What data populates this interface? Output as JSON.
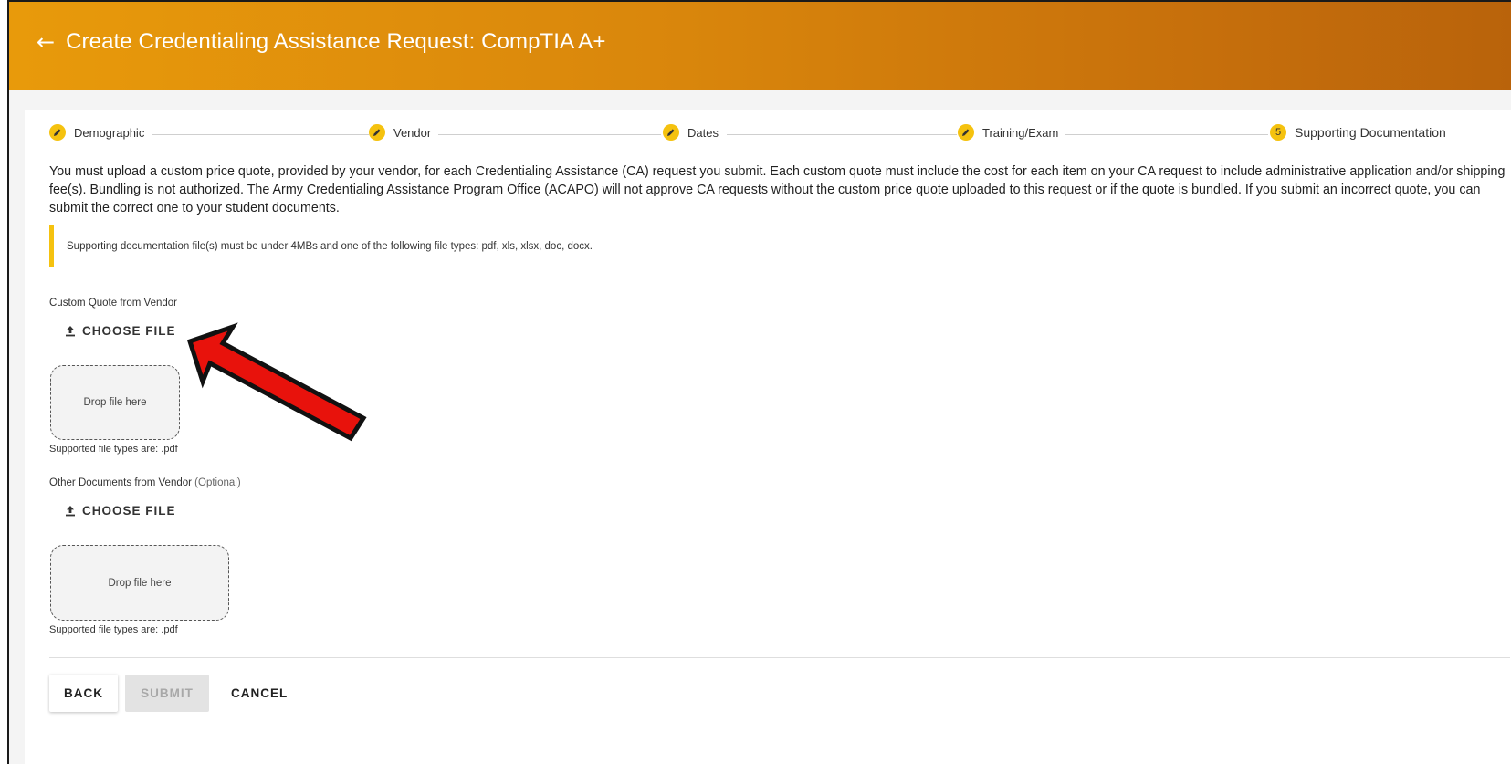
{
  "header": {
    "back_icon": "arrow-left-icon",
    "title": "Create Credentialing Assistance Request: CompTIA A+"
  },
  "stepper": {
    "steps": [
      {
        "label": "Demographic",
        "status": "complete",
        "icon": "pencil-icon"
      },
      {
        "label": "Vendor",
        "status": "complete",
        "icon": "pencil-icon"
      },
      {
        "label": "Dates",
        "status": "complete",
        "icon": "pencil-icon"
      },
      {
        "label": "Training/Exam",
        "status": "complete",
        "icon": "pencil-icon"
      },
      {
        "label": "Supporting Documentation",
        "status": "active",
        "number": "5"
      }
    ]
  },
  "intro_text": "You must upload a custom price quote, provided by your vendor, for each Credentialing Assistance (CA) request you submit. Each custom quote must include the cost for each item on your CA request to include administrative application and/or shipping fee(s). Bundling is not authorized. The Army Credentialing Assistance Program Office (ACAPO) will not approve CA requests without the custom price quote uploaded to this request or if the quote is bundled. If you submit an incorrect quote, you can submit the correct one to your student documents.",
  "note": "Supporting documentation file(s) must be under 4MBs and one of the following file types: pdf, xls, xlsx, doc, docx.",
  "custom_quote": {
    "label": "Custom Quote from Vendor",
    "choose_label": "CHOOSE FILE",
    "drop_text": "Drop file here",
    "supported": "Supported file types are: .pdf"
  },
  "other_docs": {
    "label": "Other Documents from Vendor",
    "optional": "(Optional)",
    "choose_label": "CHOOSE FILE",
    "drop_text": "Drop file here",
    "supported": "Supported file types are: .pdf"
  },
  "actions": {
    "back": "BACK",
    "submit": "SUBMIT",
    "cancel": "CANCEL"
  },
  "colors": {
    "header_start": "#e89a0b",
    "header_end": "#b9630b",
    "accent": "#f5c20f",
    "annotation": "#e8120c"
  }
}
